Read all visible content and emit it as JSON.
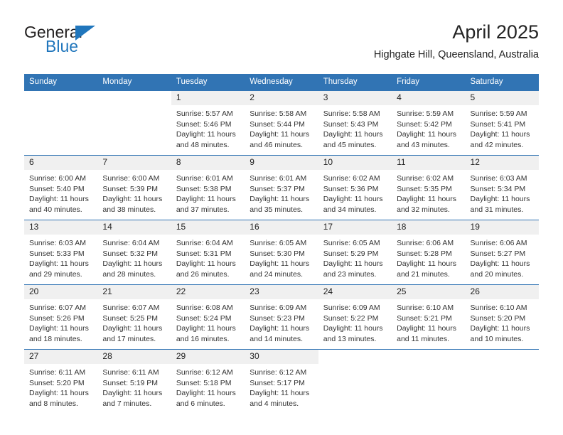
{
  "brand": {
    "name_top": "General",
    "name_bottom": "Blue",
    "triangle_icon": "triangle-icon",
    "color_dark": "#221f1f",
    "color_blue": "#2076bc"
  },
  "header": {
    "title": "April 2025",
    "subtitle": "Highgate Hill, Queensland, Australia"
  },
  "theme": {
    "header_blue": "#3174b4",
    "daynum_bg": "#f0f0f0",
    "text": "#333333"
  },
  "weekday_headers": [
    "Sunday",
    "Monday",
    "Tuesday",
    "Wednesday",
    "Thursday",
    "Friday",
    "Saturday"
  ],
  "labels": {
    "sunrise_prefix": "Sunrise:",
    "sunset_prefix": "Sunset:",
    "daylight_prefix": "Daylight:"
  },
  "weeks": [
    [
      {
        "day": "",
        "sunrise": "",
        "sunset": "",
        "daylight": ""
      },
      {
        "day": "",
        "sunrise": "",
        "sunset": "",
        "daylight": ""
      },
      {
        "day": "1",
        "sunrise": "Sunrise: 5:57 AM",
        "sunset": "Sunset: 5:46 PM",
        "daylight": "Daylight: 11 hours and 48 minutes."
      },
      {
        "day": "2",
        "sunrise": "Sunrise: 5:58 AM",
        "sunset": "Sunset: 5:44 PM",
        "daylight": "Daylight: 11 hours and 46 minutes."
      },
      {
        "day": "3",
        "sunrise": "Sunrise: 5:58 AM",
        "sunset": "Sunset: 5:43 PM",
        "daylight": "Daylight: 11 hours and 45 minutes."
      },
      {
        "day": "4",
        "sunrise": "Sunrise: 5:59 AM",
        "sunset": "Sunset: 5:42 PM",
        "daylight": "Daylight: 11 hours and 43 minutes."
      },
      {
        "day": "5",
        "sunrise": "Sunrise: 5:59 AM",
        "sunset": "Sunset: 5:41 PM",
        "daylight": "Daylight: 11 hours and 42 minutes."
      }
    ],
    [
      {
        "day": "6",
        "sunrise": "Sunrise: 6:00 AM",
        "sunset": "Sunset: 5:40 PM",
        "daylight": "Daylight: 11 hours and 40 minutes."
      },
      {
        "day": "7",
        "sunrise": "Sunrise: 6:00 AM",
        "sunset": "Sunset: 5:39 PM",
        "daylight": "Daylight: 11 hours and 38 minutes."
      },
      {
        "day": "8",
        "sunrise": "Sunrise: 6:01 AM",
        "sunset": "Sunset: 5:38 PM",
        "daylight": "Daylight: 11 hours and 37 minutes."
      },
      {
        "day": "9",
        "sunrise": "Sunrise: 6:01 AM",
        "sunset": "Sunset: 5:37 PM",
        "daylight": "Daylight: 11 hours and 35 minutes."
      },
      {
        "day": "10",
        "sunrise": "Sunrise: 6:02 AM",
        "sunset": "Sunset: 5:36 PM",
        "daylight": "Daylight: 11 hours and 34 minutes."
      },
      {
        "day": "11",
        "sunrise": "Sunrise: 6:02 AM",
        "sunset": "Sunset: 5:35 PM",
        "daylight": "Daylight: 11 hours and 32 minutes."
      },
      {
        "day": "12",
        "sunrise": "Sunrise: 6:03 AM",
        "sunset": "Sunset: 5:34 PM",
        "daylight": "Daylight: 11 hours and 31 minutes."
      }
    ],
    [
      {
        "day": "13",
        "sunrise": "Sunrise: 6:03 AM",
        "sunset": "Sunset: 5:33 PM",
        "daylight": "Daylight: 11 hours and 29 minutes."
      },
      {
        "day": "14",
        "sunrise": "Sunrise: 6:04 AM",
        "sunset": "Sunset: 5:32 PM",
        "daylight": "Daylight: 11 hours and 28 minutes."
      },
      {
        "day": "15",
        "sunrise": "Sunrise: 6:04 AM",
        "sunset": "Sunset: 5:31 PM",
        "daylight": "Daylight: 11 hours and 26 minutes."
      },
      {
        "day": "16",
        "sunrise": "Sunrise: 6:05 AM",
        "sunset": "Sunset: 5:30 PM",
        "daylight": "Daylight: 11 hours and 24 minutes."
      },
      {
        "day": "17",
        "sunrise": "Sunrise: 6:05 AM",
        "sunset": "Sunset: 5:29 PM",
        "daylight": "Daylight: 11 hours and 23 minutes."
      },
      {
        "day": "18",
        "sunrise": "Sunrise: 6:06 AM",
        "sunset": "Sunset: 5:28 PM",
        "daylight": "Daylight: 11 hours and 21 minutes."
      },
      {
        "day": "19",
        "sunrise": "Sunrise: 6:06 AM",
        "sunset": "Sunset: 5:27 PM",
        "daylight": "Daylight: 11 hours and 20 minutes."
      }
    ],
    [
      {
        "day": "20",
        "sunrise": "Sunrise: 6:07 AM",
        "sunset": "Sunset: 5:26 PM",
        "daylight": "Daylight: 11 hours and 18 minutes."
      },
      {
        "day": "21",
        "sunrise": "Sunrise: 6:07 AM",
        "sunset": "Sunset: 5:25 PM",
        "daylight": "Daylight: 11 hours and 17 minutes."
      },
      {
        "day": "22",
        "sunrise": "Sunrise: 6:08 AM",
        "sunset": "Sunset: 5:24 PM",
        "daylight": "Daylight: 11 hours and 16 minutes."
      },
      {
        "day": "23",
        "sunrise": "Sunrise: 6:09 AM",
        "sunset": "Sunset: 5:23 PM",
        "daylight": "Daylight: 11 hours and 14 minutes."
      },
      {
        "day": "24",
        "sunrise": "Sunrise: 6:09 AM",
        "sunset": "Sunset: 5:22 PM",
        "daylight": "Daylight: 11 hours and 13 minutes."
      },
      {
        "day": "25",
        "sunrise": "Sunrise: 6:10 AM",
        "sunset": "Sunset: 5:21 PM",
        "daylight": "Daylight: 11 hours and 11 minutes."
      },
      {
        "day": "26",
        "sunrise": "Sunrise: 6:10 AM",
        "sunset": "Sunset: 5:20 PM",
        "daylight": "Daylight: 11 hours and 10 minutes."
      }
    ],
    [
      {
        "day": "27",
        "sunrise": "Sunrise: 6:11 AM",
        "sunset": "Sunset: 5:20 PM",
        "daylight": "Daylight: 11 hours and 8 minutes."
      },
      {
        "day": "28",
        "sunrise": "Sunrise: 6:11 AM",
        "sunset": "Sunset: 5:19 PM",
        "daylight": "Daylight: 11 hours and 7 minutes."
      },
      {
        "day": "29",
        "sunrise": "Sunrise: 6:12 AM",
        "sunset": "Sunset: 5:18 PM",
        "daylight": "Daylight: 11 hours and 6 minutes."
      },
      {
        "day": "30",
        "sunrise": "Sunrise: 6:12 AM",
        "sunset": "Sunset: 5:17 PM",
        "daylight": "Daylight: 11 hours and 4 minutes."
      },
      {
        "day": "",
        "sunrise": "",
        "sunset": "",
        "daylight": ""
      },
      {
        "day": "",
        "sunrise": "",
        "sunset": "",
        "daylight": ""
      },
      {
        "day": "",
        "sunrise": "",
        "sunset": "",
        "daylight": ""
      }
    ]
  ]
}
